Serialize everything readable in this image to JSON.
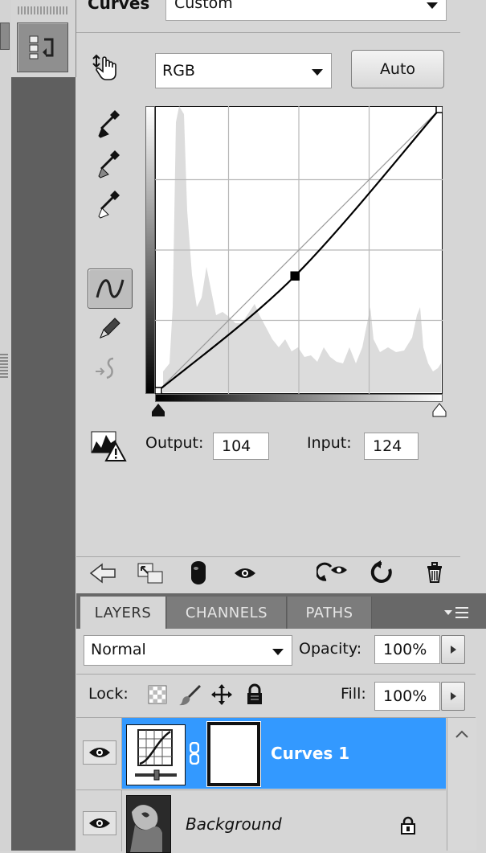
{
  "adjustments": {
    "preset_label": "Curves",
    "preset_value": "Custom",
    "channel_value": "RGB",
    "auto_label": "Auto",
    "output_label": "Output:",
    "output_value": "104",
    "input_label": "Input:",
    "input_value": "124"
  },
  "curve": {
    "points": [
      [
        0,
        0
      ],
      [
        124,
        104
      ],
      [
        255,
        255
      ]
    ]
  },
  "layers_panel": {
    "tabs": [
      "LAYERS",
      "CHANNELS",
      "PATHS"
    ],
    "blend_mode": "Normal",
    "opacity_label": "Opacity:",
    "opacity_value": "100%",
    "lock_label": "Lock:",
    "fill_label": "Fill:",
    "fill_value": "100%",
    "layers": [
      {
        "name": "Curves 1",
        "selected": true
      },
      {
        "name": "Background",
        "selected": false
      }
    ]
  },
  "colors": {
    "selected_row": "#3399ff",
    "panel_bg": "#d6d6d6",
    "tab_bar": "#686868"
  }
}
